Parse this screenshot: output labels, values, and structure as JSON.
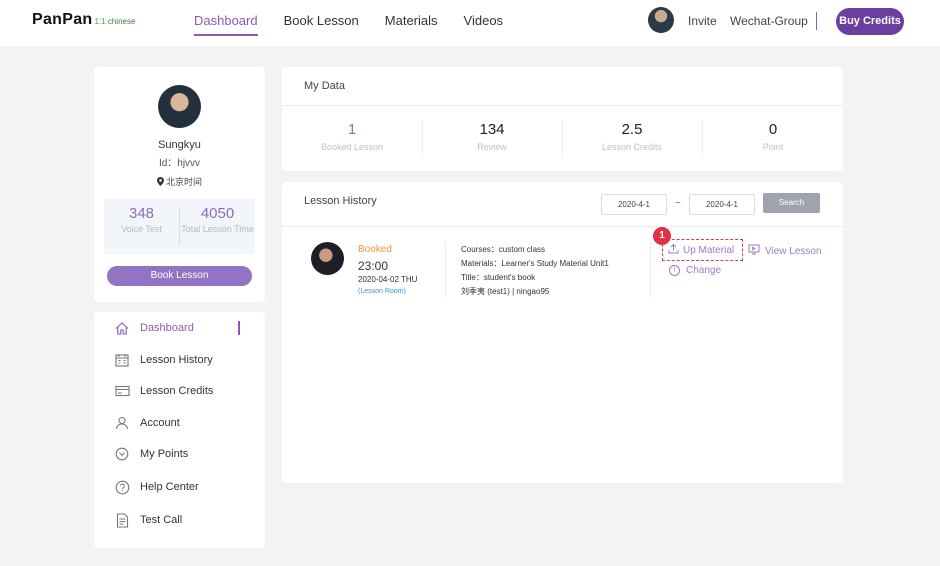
{
  "header": {
    "logo_main": "PanPan",
    "logo_oneone": "1:1",
    "logo_sub": "chinese",
    "nav": [
      "Dashboard",
      "Book Lesson",
      "Materials",
      "Videos"
    ],
    "invite": "Invite",
    "wechat": "Wechat-Group",
    "buy_credits": "Buy Credits"
  },
  "profile": {
    "name": "Sungkyu",
    "id": "Id：hjvvv",
    "timezone": "北京时间",
    "stats": [
      {
        "value": "348",
        "label": "Voice Test"
      },
      {
        "value": "4050",
        "label": "Total Lesson Time"
      }
    ],
    "book_button": "Book Lesson"
  },
  "menu": {
    "items": [
      {
        "label": "Dashboard",
        "icon": "home-icon"
      },
      {
        "label": "Lesson History",
        "icon": "calendar-icon"
      },
      {
        "label": "Lesson Credits",
        "icon": "credit-card-icon"
      },
      {
        "label": "Account",
        "icon": "user-icon"
      },
      {
        "label": "My Points",
        "icon": "points-icon"
      },
      {
        "label": "Help Center",
        "icon": "help-icon"
      },
      {
        "label": "Test Call",
        "icon": "document-icon"
      }
    ]
  },
  "my_data": {
    "title": "My Data",
    "cells": [
      {
        "value": "1",
        "label": "Booked Lesson"
      },
      {
        "value": "134",
        "label": "Review"
      },
      {
        "value": "2.5",
        "label": "Lesson Credits"
      },
      {
        "value": "0",
        "label": "Point"
      }
    ]
  },
  "history": {
    "title": "Lesson History",
    "date_from": "2020-4-1",
    "date_to": "2020-4-1",
    "tilde": "~",
    "search": "Search",
    "lesson": {
      "status": "Booked",
      "time": "23:00",
      "date": "2020-04-02 THU",
      "room": "(Lesson Room)",
      "course": "Courses：custom class",
      "materials": "Materials：Learner's Study Material Unit1",
      "title": "Title：student's book",
      "people": "刘季夷 (test1)  |  ningao95",
      "badge": "1",
      "up_material": "Up Material",
      "view_lesson": "View Lesson",
      "change": "Change"
    }
  },
  "colors": {
    "accent": "#8e5ab5",
    "buy_button": "#6b3fa0",
    "booked": "#f0953a",
    "highlight_box": "#e0354a"
  }
}
